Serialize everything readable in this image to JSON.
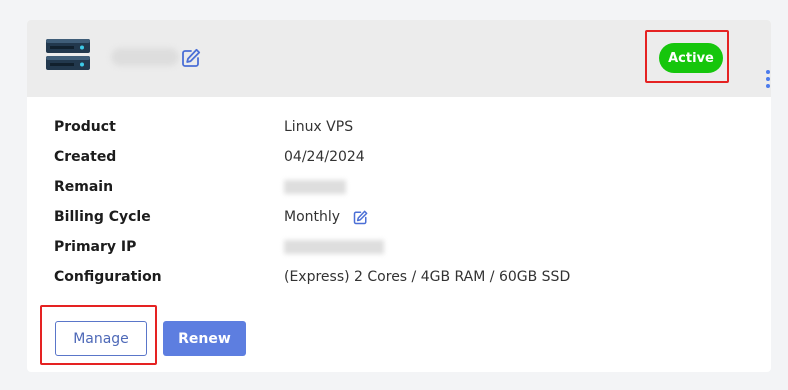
{
  "service": {
    "status_label": "Active",
    "status_color": "#16c60c",
    "accent_color": "#5d7ee0",
    "icons": {
      "server": "server-stack-icon",
      "edit": "edit-icon",
      "more": "kebab-menu-icon"
    }
  },
  "details": {
    "rows": [
      {
        "label": "Product",
        "value": "Linux VPS"
      },
      {
        "label": "Created",
        "value": "04/24/2024"
      },
      {
        "label": "Remain",
        "value": ""
      },
      {
        "label": "Billing Cycle",
        "value": "Monthly"
      },
      {
        "label": "Primary IP",
        "value": ""
      },
      {
        "label": "Configuration",
        "value": "(Express) 2 Cores / 4GB RAM / 60GB SSD"
      }
    ]
  },
  "actions": {
    "manage_label": "Manage",
    "renew_label": "Renew"
  }
}
